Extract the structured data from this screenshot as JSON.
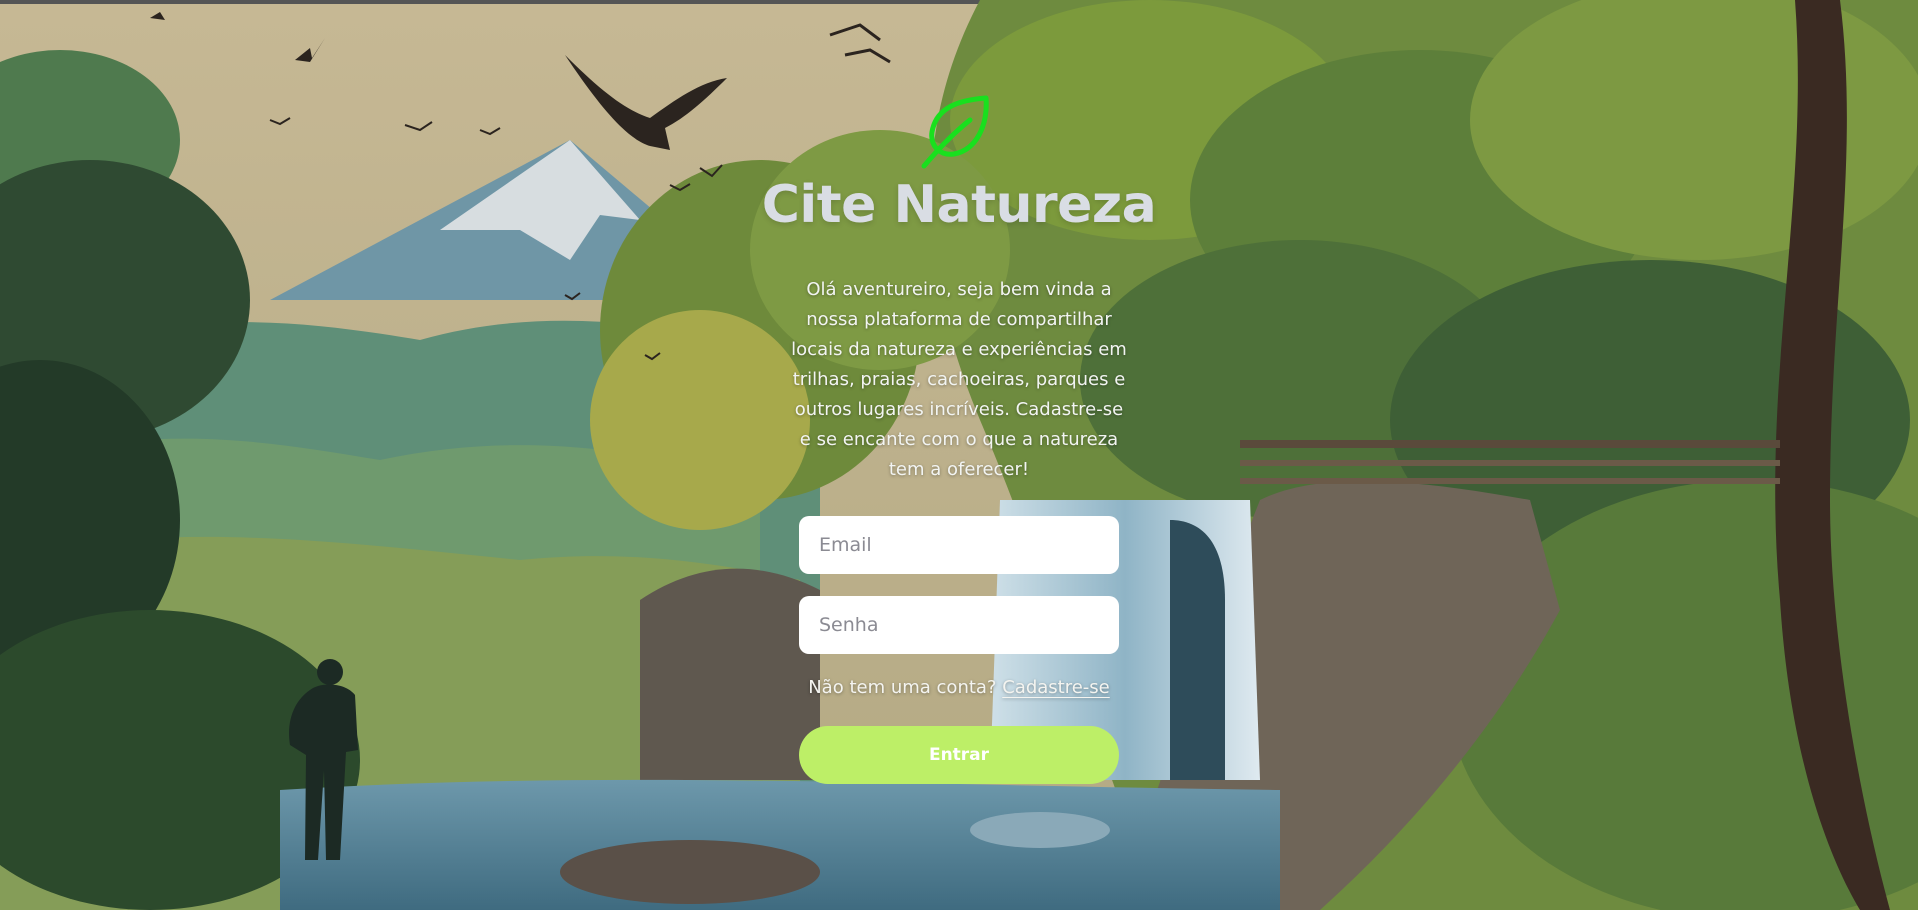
{
  "brand": {
    "title": "Cite Natureza",
    "logo_icon": "leaf-icon",
    "logo_color": "#19e01e"
  },
  "intro": {
    "text": "Olá aventureiro, seja bem vinda a nossa plataforma de compartilhar locais da natureza e experiências em trilhas, praias, cachoeiras, parques e outros lugares incríveis. Cadastre-se e se encante com o que a natureza tem a oferecer!"
  },
  "form": {
    "email_placeholder": "Email",
    "email_value": "",
    "password_placeholder": "Senha",
    "password_value": "",
    "signup_prompt": "Não tem uma conta?",
    "signup_link": "Cadastre-se",
    "submit_label": "Entrar"
  },
  "colors": {
    "accent_button": "#bdef67",
    "title_text": "#d9dde4"
  }
}
